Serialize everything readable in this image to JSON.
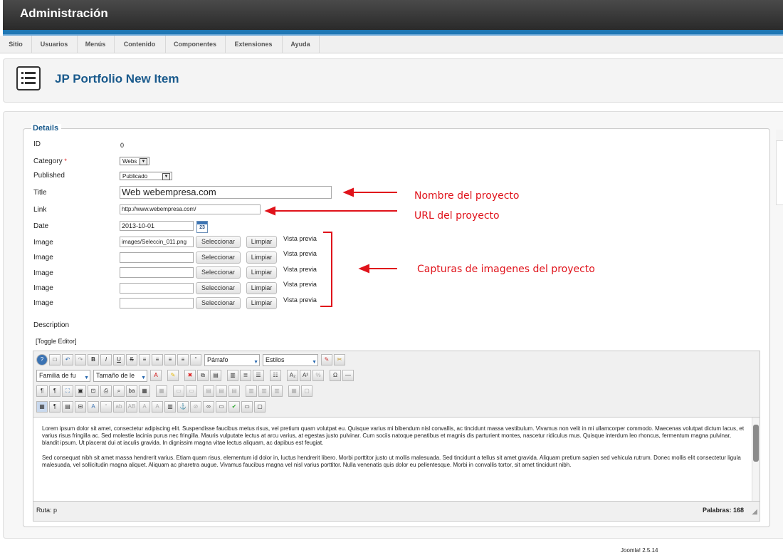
{
  "app": {
    "title": "Administración"
  },
  "menu": [
    "Sitio",
    "Usuarios",
    "Menús",
    "Contenido",
    "Componentes",
    "Extensiones",
    "Ayuda"
  ],
  "page": {
    "title": "JP Portfolio New Item",
    "icon": "article-list-icon"
  },
  "form": {
    "legend": "Details",
    "id_label": "ID",
    "id_value": "0",
    "category_label": "Category",
    "required_mark": "*",
    "category_value": "Webs",
    "published_label": "Published",
    "published_value": "Publicado",
    "title_label": "Title",
    "title_value": "Web webempresa.com",
    "link_label": "Link",
    "link_value": "http://www.webempresa.com/",
    "date_label": "Date",
    "date_value": "2013-10-01",
    "calendar_day": "23",
    "images": [
      {
        "label": "Image",
        "value": "images/Seleccin_011.png",
        "select": "Seleccionar",
        "clear": "Limpiar",
        "preview": "Vista previa"
      },
      {
        "label": "Image",
        "value": "",
        "select": "Seleccionar",
        "clear": "Limpiar",
        "preview": "Vista previa"
      },
      {
        "label": "Image",
        "value": "",
        "select": "Seleccionar",
        "clear": "Limpiar",
        "preview": "Vista previa"
      },
      {
        "label": "Image",
        "value": "",
        "select": "Seleccionar",
        "clear": "Limpiar",
        "preview": "Vista previa"
      },
      {
        "label": "Image",
        "value": "",
        "select": "Seleccionar",
        "clear": "Limpiar",
        "preview": "Vista previa"
      }
    ],
    "description_label": "Description",
    "toggle_editor": "[Toggle Editor]"
  },
  "annotations": {
    "name": "Nombre del proyecto",
    "url": "URL del proyecto",
    "captures": "Capturas de imagenes del proyecto",
    "color": "#e0131b"
  },
  "editor": {
    "format_select": "Párrafo",
    "styles_select": "Estilos",
    "font_family_select": "Familia de fu",
    "font_size_select": "Tamaño de le",
    "paragraph1": "Lorem ipsum dolor sit amet, consectetur adipiscing elit. Suspendisse faucibus metus risus, vel pretium quam volutpat eu. Quisque varius mi bibendum nisl convallis, ac tincidunt massa vestibulum. Vivamus non velit in mi ullamcorper commodo. Maecenas volutpat dictum lacus, et varius risus fringilla ac. Sed molestie lacinia purus nec fringilla. Mauris vulputate lectus at arcu varius, at egestas justo pulvinar. Cum sociis natoque penatibus et magnis dis parturient montes, nascetur ridiculus mus. Quisque interdum leo rhoncus, fermentum magna pulvinar, blandit ipsum. Ut placerat dui at iaculis gravida. In dignissim magna vitae lectus aliquam, ac dapibus est feugiat.",
    "paragraph2": "Sed consequat nibh sit amet massa hendrerit varius. Etiam quam risus, elementum id dolor in, luctus hendrerit libero. Morbi porttitor justo ut mollis malesuada. Sed tincidunt a tellus sit amet gravida. Aliquam pretium sapien sed vehicula rutrum. Donec mollis elit consectetur ligula malesuada, vel sollicitudin magna aliquet. Aliquam ac pharetra augue. Vivamus faucibus magna vel nisl varius porttitor. Nulla venenatis quis dolor eu pellentesque. Morbi in convallis tortor, sit amet tincidunt nibh.",
    "path": "Ruta: p",
    "word_count": "Palabras: 168"
  },
  "footer": {
    "version": "Joomla! 2.5.14"
  }
}
